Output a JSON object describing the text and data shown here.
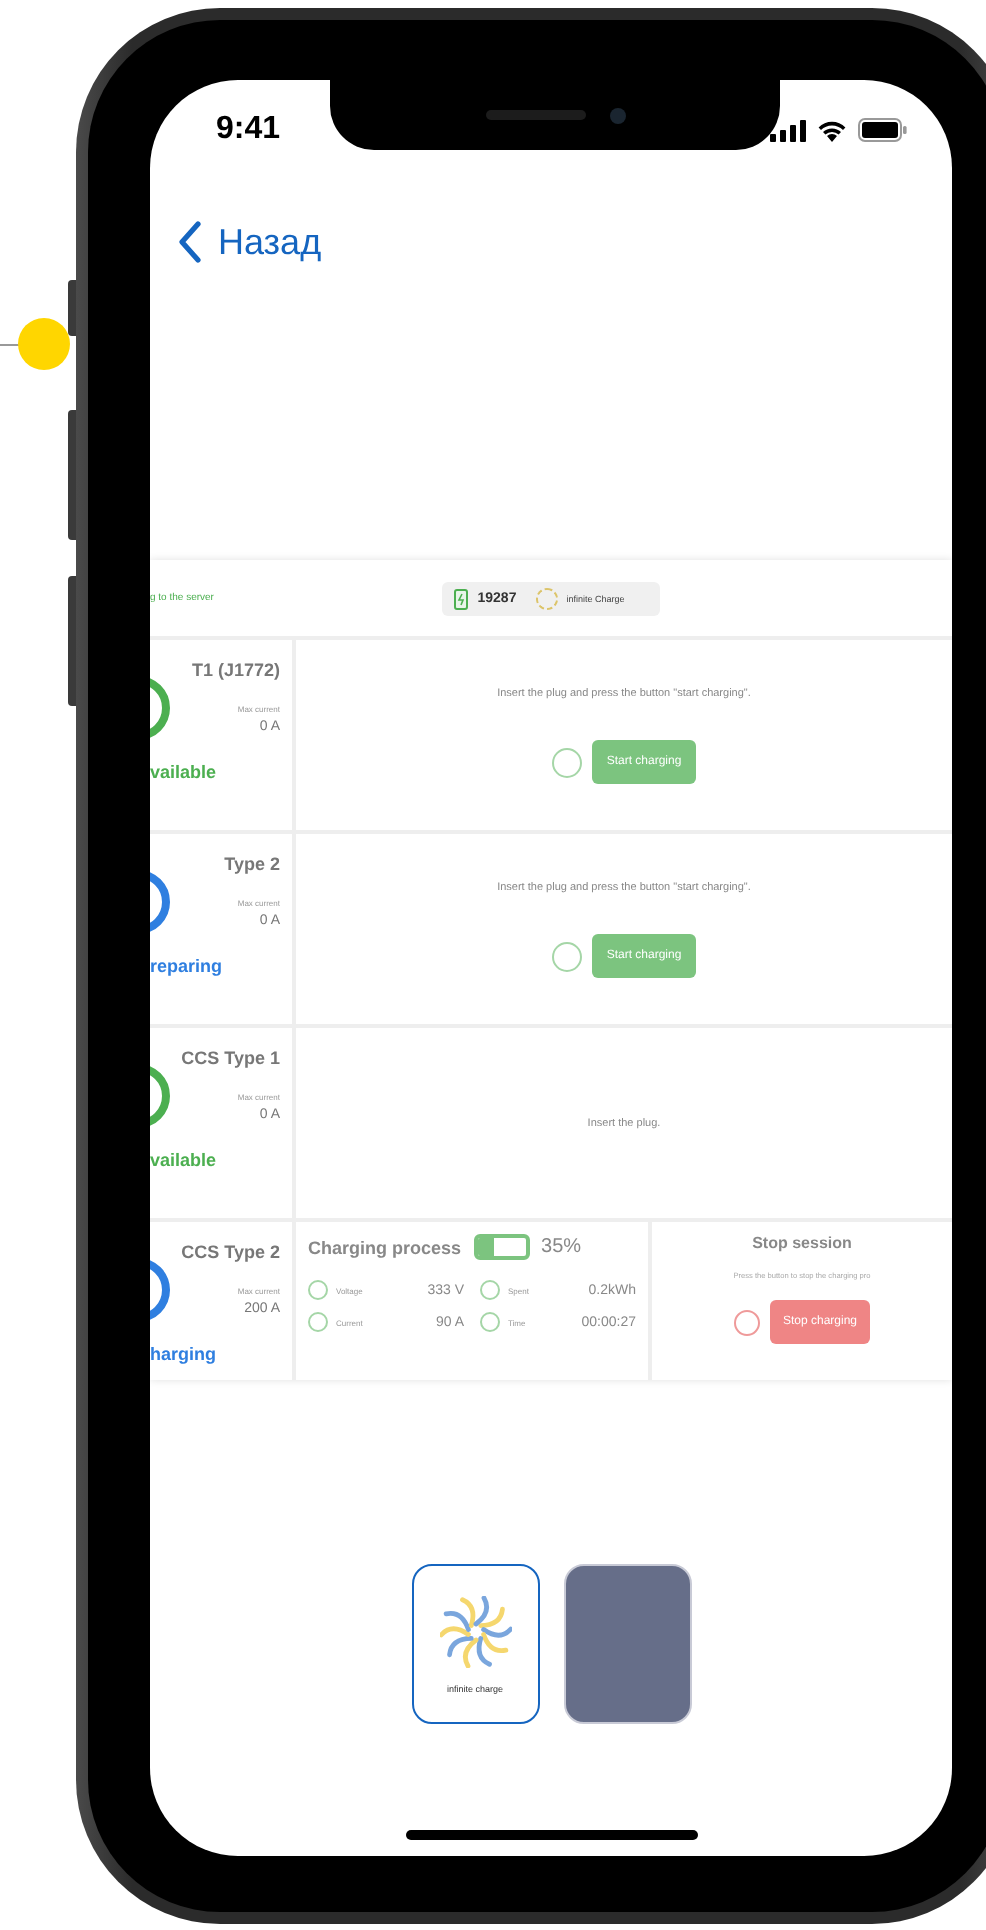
{
  "status_bar": {
    "time": "9:41"
  },
  "nav": {
    "back_label": "Назад"
  },
  "preview": {
    "header": {
      "status": "g to the server",
      "station_id": "19287",
      "brand": "infinite Charge"
    },
    "connectors": [
      {
        "kind": "start",
        "name": "T1 (J1772)",
        "max_label": "Max current",
        "max_value": "0 A",
        "status": "vailable",
        "color": "#4caf50",
        "message": "Insert the plug and press the button \"start charging\".",
        "button": "Start charging"
      },
      {
        "kind": "start",
        "name": "Type 2",
        "max_label": "Max current",
        "max_value": "0 A",
        "status": "reparing",
        "color": "#2f7fe0",
        "message": "Insert the plug and press the button \"start charging\".",
        "button": "Start charging"
      },
      {
        "kind": "message",
        "name": "CCS Type 1",
        "max_label": "Max current",
        "max_value": "0 A",
        "status": "vailable",
        "color": "#4caf50",
        "message": "Insert the plug."
      },
      {
        "kind": "session",
        "name": "CCS Type 2",
        "max_label": "Max current",
        "max_value": "200 A",
        "status": "harging",
        "color": "#2f7fe0",
        "process_title": "Charging process",
        "level": 0.35,
        "percent": "35%",
        "metrics": [
          {
            "label": "Voltage",
            "value": "333 V"
          },
          {
            "label": "Spent",
            "value": "0.2kWh"
          },
          {
            "label": "Current",
            "value": "90 A"
          },
          {
            "label": "Time",
            "value": "00:00:27"
          }
        ],
        "stop_title": "Stop session",
        "stop_hint": "Press the button to stop the charging pro",
        "button": "Stop charging"
      }
    ]
  },
  "thumbnails": [
    {
      "kind": "logo",
      "caption": "infinite charge",
      "selected": true
    },
    {
      "kind": "blank",
      "selected": false
    }
  ]
}
